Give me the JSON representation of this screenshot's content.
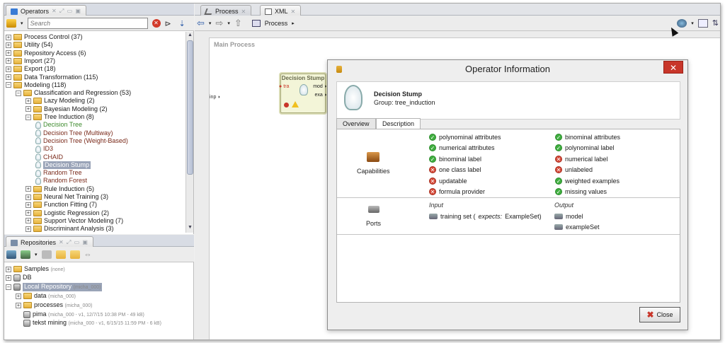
{
  "operators_panel": {
    "tab_label": "Operators",
    "search_placeholder": "Search",
    "tree": [
      {
        "label": "Process Control (37)",
        "level": 0,
        "type": "folder"
      },
      {
        "label": "Utility (54)",
        "level": 0,
        "type": "folder"
      },
      {
        "label": "Repository Access (6)",
        "level": 0,
        "type": "folder"
      },
      {
        "label": "Import (27)",
        "level": 0,
        "type": "folder"
      },
      {
        "label": "Export (18)",
        "level": 0,
        "type": "folder"
      },
      {
        "label": "Data Transformation (115)",
        "level": 0,
        "type": "folder"
      },
      {
        "label": "Modeling (118)",
        "level": 0,
        "type": "folder"
      },
      {
        "label": "Classification and Regression (53)",
        "level": 1,
        "type": "folder"
      },
      {
        "label": "Lazy Modeling (2)",
        "level": 2,
        "type": "folder"
      },
      {
        "label": "Bayesian Modeling (2)",
        "level": 2,
        "type": "folder"
      },
      {
        "label": "Tree Induction (8)",
        "level": 2,
        "type": "folder"
      },
      {
        "label": "Decision Tree",
        "level": 3,
        "type": "leaf",
        "color": "green"
      },
      {
        "label": "Decision Tree (Multiway)",
        "level": 3,
        "type": "leaf",
        "color": "red"
      },
      {
        "label": "Decision Tree (Weight-Based)",
        "level": 3,
        "type": "leaf",
        "color": "red"
      },
      {
        "label": "ID3",
        "level": 3,
        "type": "leaf",
        "color": "red"
      },
      {
        "label": "CHAID",
        "level": 3,
        "type": "leaf",
        "color": "red"
      },
      {
        "label": "Decision Stump",
        "level": 3,
        "type": "leaf",
        "color": "selected"
      },
      {
        "label": "Random Tree",
        "level": 3,
        "type": "leaf",
        "color": "red"
      },
      {
        "label": "Random Forest",
        "level": 3,
        "type": "leaf",
        "color": "red"
      },
      {
        "label": "Rule Induction (5)",
        "level": 2,
        "type": "folder"
      },
      {
        "label": "Neural Net Training (3)",
        "level": 2,
        "type": "folder"
      },
      {
        "label": "Function Fitting (7)",
        "level": 2,
        "type": "folder"
      },
      {
        "label": "Logistic Regression (2)",
        "level": 2,
        "type": "folder"
      },
      {
        "label": "Support Vector Modeling (7)",
        "level": 2,
        "type": "folder"
      },
      {
        "label": "Discriminant Analysis (3)",
        "level": 2,
        "type": "folder"
      }
    ]
  },
  "repositories_panel": {
    "tab_label": "Repositories",
    "items": [
      {
        "label": "Samples",
        "meta": "(none)",
        "level": 0
      },
      {
        "label": "DB",
        "meta": "",
        "level": 0
      },
      {
        "label": "Local Repository",
        "meta": "(micha_000)",
        "level": 0
      },
      {
        "label": "data",
        "meta": "(micha_000)",
        "level": 1
      },
      {
        "label": "processes",
        "meta": "(micha_000)",
        "level": 1
      },
      {
        "label": "pima",
        "meta": "(micha_000 - v1, 12/7/15 10:38 PM - 49 kB)",
        "level": 1
      },
      {
        "label": "tekst mining",
        "meta": "(micha_000 - v1, 6/15/15 11:59 PM - 6 kB)",
        "level": 1
      }
    ]
  },
  "process_panel": {
    "tabs": [
      "Process",
      "XML"
    ],
    "breadcrumb": "Process",
    "canvas_title": "Main Process",
    "input_port": "inp",
    "operator_box": {
      "title": "Decision Stump",
      "port_in": "tra",
      "port_out_1": "mod",
      "port_out_2": "exa"
    }
  },
  "dialog": {
    "title": "Operator Information",
    "close_x": "✕",
    "operator_name": "Decision Stump",
    "group": "Group: tree_induction",
    "tabs": [
      "Overview",
      "Description"
    ],
    "capabilities_label": "Capabilities",
    "capabilities_left": [
      {
        "label": "polynominal attributes",
        "ok": true
      },
      {
        "label": "numerical attributes",
        "ok": true
      },
      {
        "label": "binominal label",
        "ok": true
      },
      {
        "label": "one class label",
        "ok": false
      },
      {
        "label": "updatable",
        "ok": false
      },
      {
        "label": "formula provider",
        "ok": false
      }
    ],
    "capabilities_right": [
      {
        "label": "binominal attributes",
        "ok": true
      },
      {
        "label": "polynominal label",
        "ok": true
      },
      {
        "label": "numerical label",
        "ok": false
      },
      {
        "label": "unlabeled",
        "ok": false
      },
      {
        "label": "weighted examples",
        "ok": true
      },
      {
        "label": "missing values",
        "ok": true
      }
    ],
    "ports_label": "Ports",
    "input_header": "Input",
    "output_header": "Output",
    "input_item_prefix": "training set (",
    "input_item_expects": "expects:",
    "input_item_suffix": " ExampleSet)",
    "outputs": [
      "model",
      "exampleSet"
    ],
    "close_button": "Close"
  },
  "colors": {
    "accent_red": "#c8362a",
    "ok_green": "#3fae3f",
    "leaf_green": "#3c8a2c",
    "leaf_red": "#7a2a1a",
    "selection": "#9aa4b8"
  }
}
